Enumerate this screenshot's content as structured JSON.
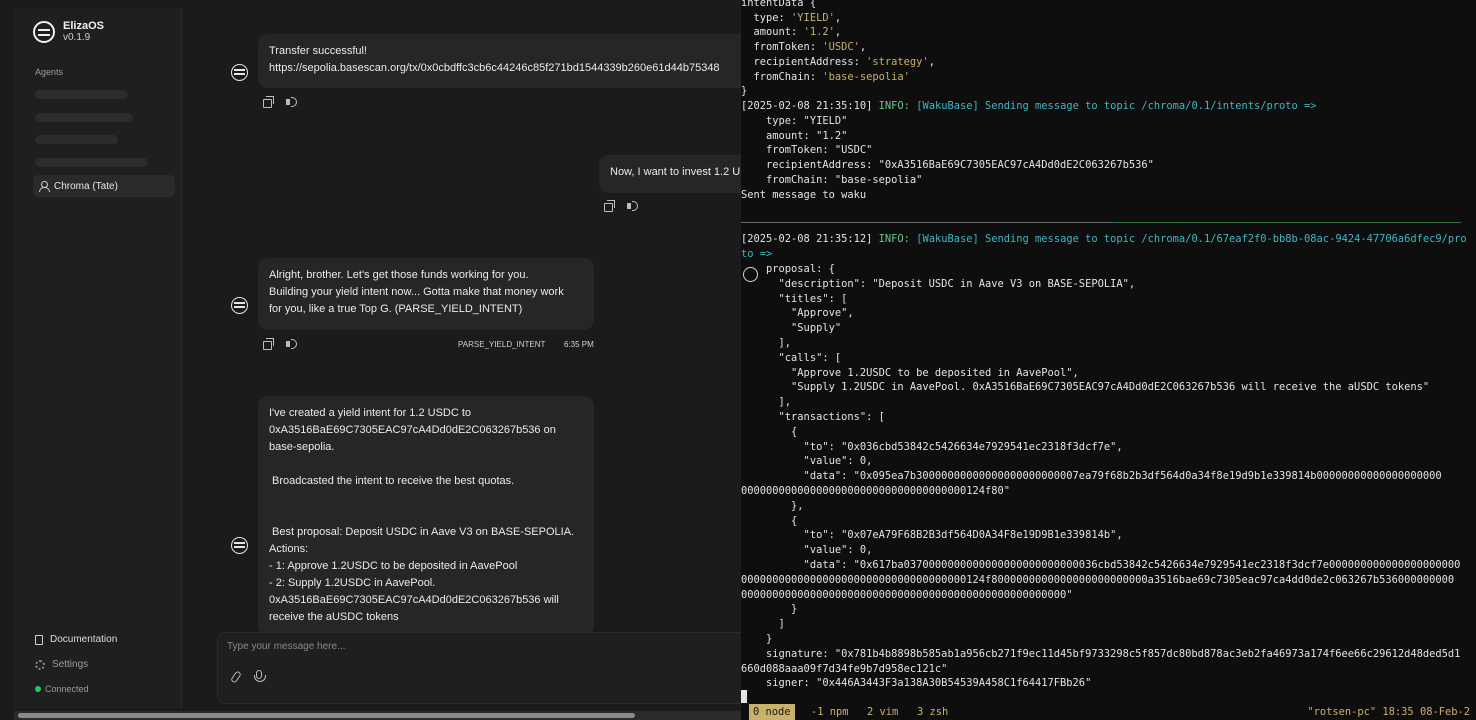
{
  "sidebar": {
    "app_name": "ElizaOS",
    "version": "v0.1.9",
    "agents_heading": "Agents",
    "agent_name": "Chroma (Tate)",
    "documentation": "Documentation",
    "settings": "Settings",
    "status": "Connected"
  },
  "chat": {
    "msg1": {
      "line1": "Transfer successful!",
      "line2": "https://sepolia.basescan.org/tx/0x0cbdffc3cb6c44246c85f271bd1544339b260e61d44b75348"
    },
    "user_msg": "Now, I want to invest 1.2 U",
    "msg2": {
      "line1": "Alright, brother. Let's get those funds working for you.",
      "line2": "Building your yield intent now... Gotta make that money work",
      "line3": "for you, like a true Top G. (PARSE_YIELD_INTENT)",
      "action": "PARSE_YIELD_INTENT",
      "time": "6:35 PM"
    },
    "msg3": {
      "lines": [
        "I've created a yield intent for 1.2 USDC to",
        "0xA3516BaE69C7305EAC97cA4Dd0dE2C063267b536 on",
        "base-sepolia.",
        "",
        " Broadcasted the intent to receive the best quotas.",
        "",
        "",
        " Best proposal: Deposit USDC in Aave V3 on BASE-SEPOLIA.",
        "Actions:",
        "- 1: Approve 1.2USDC to be deposited in AavePool",
        "- 2: Supply 1.2USDC in AavePool.",
        "0xA3516BaE69C7305EAC97cA4Dd0dE2C063267b536 will",
        "receive the aUSDC tokens"
      ]
    },
    "input_placeholder": "Type your message here..."
  },
  "terminal": {
    "intent_block": [
      "intentData {",
      "  type: 'YIELD',",
      "  amount: '1.2',",
      "  fromToken: 'USDC',",
      "  recipientAddress: 'strategy',",
      "  fromChain: 'base-sepolia'",
      "}"
    ],
    "log1": {
      "timestamp": "[2025-02-08 21:35:10]",
      "level": "INFO:",
      "message": "[WakuBase] Sending message to topic /chroma/0.1/intents/proto =>"
    },
    "sent_block": [
      "    type: \"YIELD\"",
      "    amount: \"1.2\"",
      "    fromToken: \"USDC\"",
      "    recipientAddress: \"0xA3516BaE69C7305EAC97cA4Dd0dE2C063267b536\"",
      "    fromChain: \"base-sepolia\"",
      "Sent message to waku"
    ],
    "log2": {
      "timestamp": "[2025-02-08 21:35:12]",
      "level": "INFO:",
      "message": "[WakuBase] Sending message to topic /chroma/0.1/67eaf2f0-bb8b-08ac-9424-47706a6dfec9/pro",
      "cont": "to =>"
    },
    "proposal_lines": [
      "    proposal: {",
      "      \"description\": \"Deposit USDC in Aave V3 on BASE-SEPOLIA\",",
      "      \"titles\": [",
      "        \"Approve\",",
      "        \"Supply\"",
      "      ],",
      "      \"calls\": [",
      "        \"Approve 1.2USDC to be deposited in AavePool\",",
      "        \"Supply 1.2USDC in AavePool. 0xA3516BaE69C7305EAC97cA4Dd0dE2C063267b536 will receive the aUSDC tokens\"",
      "      ],",
      "      \"transactions\": [",
      "        {",
      "          \"to\": \"0x036cbd53842c5426634e7929541ec2318f3dcf7e\",",
      "          \"value\": 0,",
      "          \"data\": \"0x095ea7b30000000000000000000000007ea79f68b2b3df564d0a34f8e19d9b1e339814b00000000000000000000",
      "000000000000000000000000000000000000124f80\"",
      "        },",
      "        {",
      "          \"to\": \"0x07eA79F68B2B3df564D0A34F8e19D9B1e339814b\",",
      "          \"value\": 0,",
      "          \"data\": \"0x617ba0370000000000000000000000000036cbd53842c5426634e7929541ec2318f3dcf7e000000000000000000000",
      "000000000000000000000000000000000000124f8000000000000000000000000a3516bae69c7305eac97ca4dd0de2c063267b536000000000",
      "0000000000000000000000000000000000000000000000000000\"",
      "        }",
      "      ]",
      "    }",
      "    signature: \"0x781b4b8898b585ab1a956cb271f9ec11d45bf9733298c5f857dc80bd878ac3eb2fa46973a174f6ee66c29612d48ded5d1",
      "660d088aaa09f7d34fe9b7d958ec121c\"",
      "    signer: \"0x446A3443F3a138A30B54539A458C1f64417FBb26\""
    ],
    "tmux": {
      "win0": "0 node",
      "win1": "-1 npm",
      "win2": "2 vim",
      "win3": "3 zsh",
      "right": "\"rotsen-pc\" 18:35 08-Feb-2"
    }
  }
}
